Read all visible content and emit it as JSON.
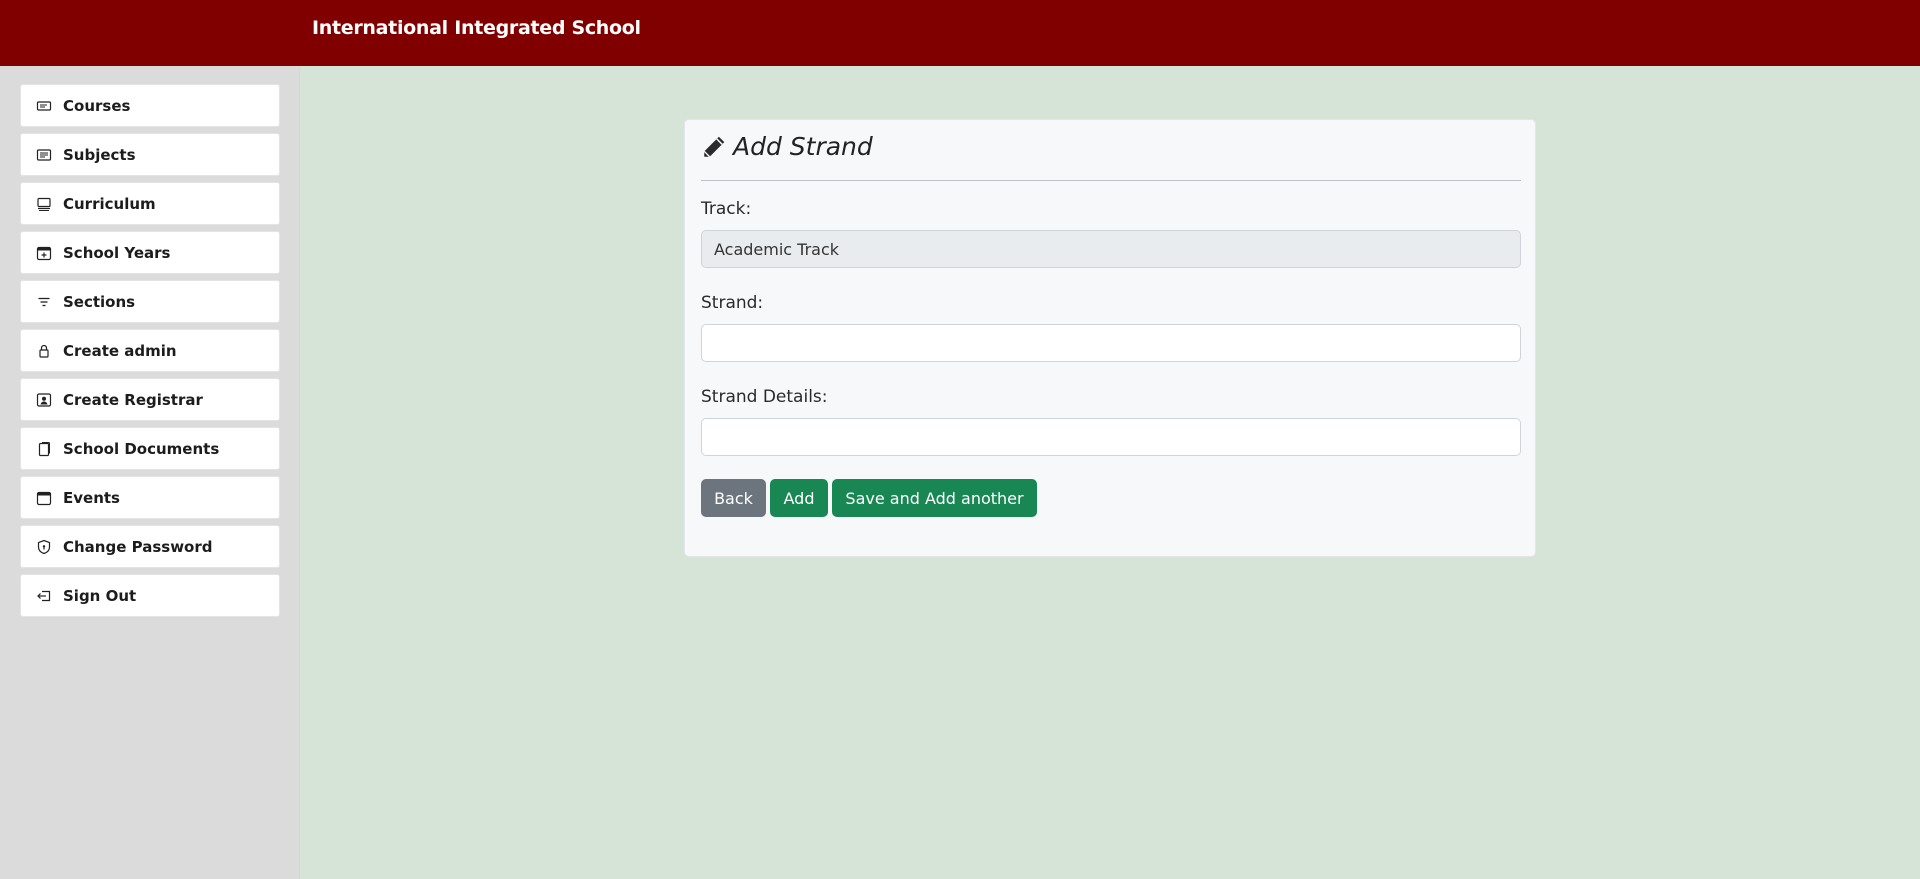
{
  "header": {
    "title": "International Integrated School",
    "color": "#800000"
  },
  "sidebar": {
    "items": [
      {
        "label": "Courses",
        "icon": "ticket-icon"
      },
      {
        "label": "Subjects",
        "icon": "list-card-icon"
      },
      {
        "label": "Curriculum",
        "icon": "layers-icon"
      },
      {
        "label": "School Years",
        "icon": "calendar-plus-icon"
      },
      {
        "label": "Sections",
        "icon": "filter-icon"
      },
      {
        "label": "Create admin",
        "icon": "lock-icon"
      },
      {
        "label": "Create Registrar",
        "icon": "person-badge-icon"
      },
      {
        "label": "School Documents",
        "icon": "documents-icon"
      },
      {
        "label": "Events",
        "icon": "calendar-icon"
      },
      {
        "label": "Change Password",
        "icon": "shield-lock-icon"
      },
      {
        "label": "Sign Out",
        "icon": "sign-out-icon"
      }
    ]
  },
  "form": {
    "title": "Add Strand",
    "icon": "pencil-icon",
    "track_label": "Track:",
    "track_value": "Academic Track",
    "strand_label": "Strand:",
    "strand_value": "",
    "details_label": "Strand Details:",
    "details_value": "",
    "buttons": {
      "back": "Back",
      "add": "Add",
      "save_add": "Save and Add another"
    }
  },
  "colors": {
    "accent": "#198754",
    "secondary": "#6c757d",
    "page_bg": "#d6e4d7"
  }
}
